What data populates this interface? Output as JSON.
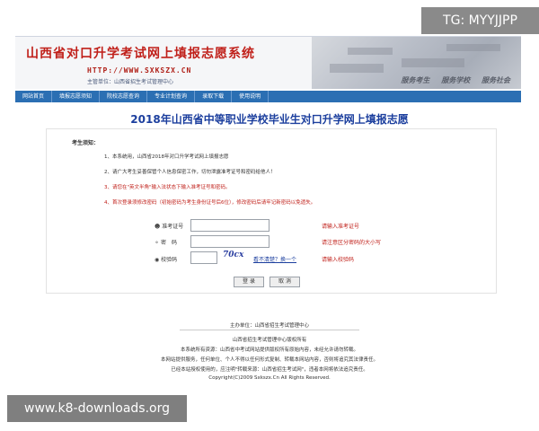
{
  "watermarks": {
    "tg": "TG: MYYJJPP",
    "url": "www.k8-downloads.org"
  },
  "banner": {
    "title": "山西省对口升学考试网上填报志愿系统",
    "url": "HTTP://WWW.SXKSZX.CN",
    "sponsor": "主管单位：山西省招生考试管理中心",
    "slogans": [
      "服务考生",
      "服务学校",
      "服务社会"
    ]
  },
  "nav": {
    "items": [
      "网站首页",
      "填报志愿须知",
      "院校志愿查询",
      "专业计划查询",
      "录取下载",
      "使用说明"
    ]
  },
  "page": {
    "title": "2018年山西省中等职业学校毕业生对口升学网上填报志愿"
  },
  "notice": {
    "heading": "考生须知：",
    "items": [
      "1、本系统用，山西省2018年对口升学考试网上填报志愿",
      "2、请广大考生妥善保管个人信息保密工作，切勿泄露准考证号和密码给他人！",
      "3、请您在\"英文半角\"输入法状态下输入准考证号和密码。",
      "4、首次登录须修改密码（初始密码为考生身份证号后6位），修改密码后请牢记新密码以免遗失。"
    ]
  },
  "form": {
    "ticket_label": "准考证号",
    "ticket_hint": "请输入准考证号",
    "password_label": "密　码",
    "password_hint": "请注意区分密码的大小写",
    "captcha_label": "校验码",
    "captcha_value": "70cx",
    "captcha_link": "看不清楚？换一个",
    "captcha_hint": "请输入校验码",
    "login_button": "登 录",
    "cancel_button": "取 消"
  },
  "footer": {
    "line1": "主办单位：山西省招生考试管理中心",
    "line2": "山西省招生考试管理中心版权所有",
    "line3": "本系统所有资源：山西省中考试网站提供版权所有原始内容，未经允许请勿转载。",
    "line4": "本网站提供服务，任何单位、个人不得以任何形式复制、转载本网站内容，否则将追究其法律责任。",
    "line5": "已经本站授权使用的，应注明\"转载来源：山西省招生考试网\"，违者本网将依法追究责任。",
    "copyright": "Copyright(C)2009 Sxkszx.Cn All Rights Reserved."
  }
}
